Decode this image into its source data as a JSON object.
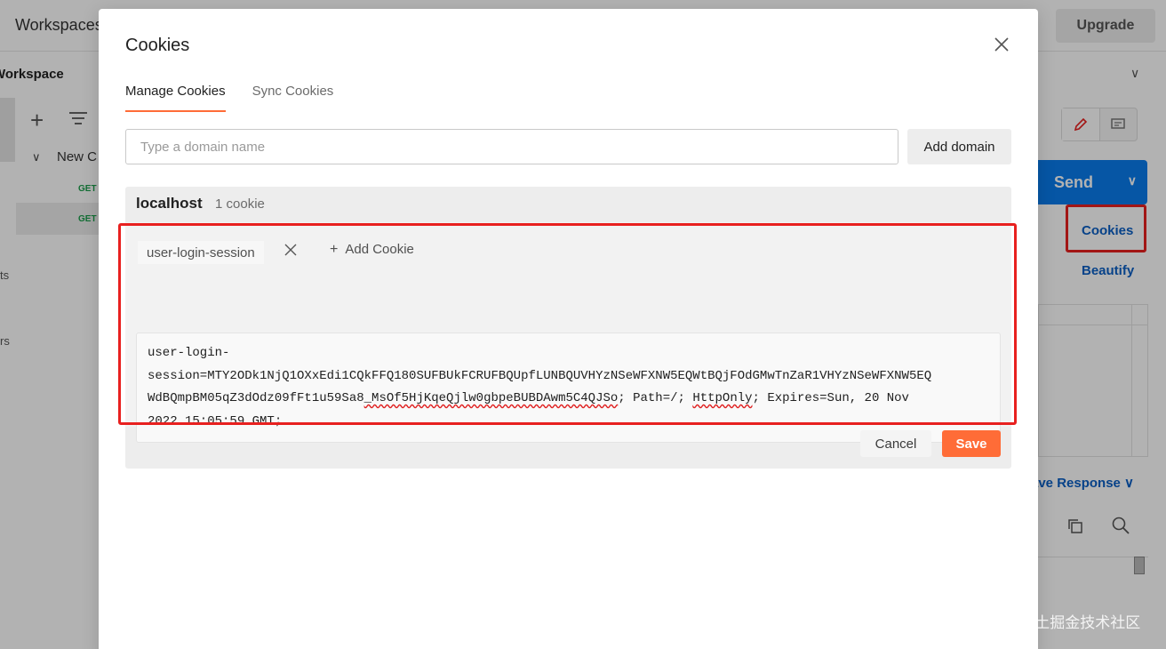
{
  "background": {
    "topbar": {
      "title": "Workspaces",
      "upgrade_label": "Upgrade"
    },
    "sidebar": {
      "workspace_title": "Workspace",
      "collection_label": "New C",
      "requests": [
        {
          "method": "GET"
        },
        {
          "method": "GET"
        }
      ],
      "left_fragments": [
        "ts",
        "rs"
      ]
    },
    "request": {
      "send_label": "Send",
      "cookies_label": "Cookies",
      "beautify_label": "Beautify",
      "save_response_label": "ave Response"
    }
  },
  "modal": {
    "title": "Cookies",
    "tabs": [
      {
        "label": "Manage Cookies",
        "active": true
      },
      {
        "label": "Sync Cookies",
        "active": false
      }
    ],
    "domain_input": {
      "placeholder": "Type a domain name",
      "value": ""
    },
    "add_domain_label": "Add domain",
    "domain": {
      "name": "localhost",
      "count": "1 cookie",
      "cookies": [
        {
          "name": "user-login-session"
        }
      ],
      "add_cookie_label": "Add Cookie",
      "editor": {
        "line1": "user-login-",
        "line2": "session=MTY2ODk1NjQ1OXxEdi1CQkFFQ180SUFBUkFCRUFBQUpfLUNBQUVHYzNSeWFXNW5EQWtBQjFOdGMwTnZaR1VHYzNSeWFXNW5EQ",
        "line3_a": "WdBQmpBM05qZ3dOdz09fFt1u59Sa8",
        "line3_b": "_MsOf5HjKqeQjlw0gbpeBUBDAwm5C4QJSo",
        "line3_c": "; Path=/; ",
        "line3_d": "HttpOnly",
        "line3_e": "; Expires=Sun, 20 Nov",
        "line4": "2022 15:05:59 GMT;"
      }
    },
    "cancel_label": "Cancel",
    "save_label": "Save"
  },
  "watermark": "@稀土掘金技术社区",
  "colors": {
    "accent": "#ff6c37",
    "send": "#097bed",
    "link": "#0b5fc4",
    "highlight": "#e8201f",
    "method_get": "#1b9e4b"
  }
}
